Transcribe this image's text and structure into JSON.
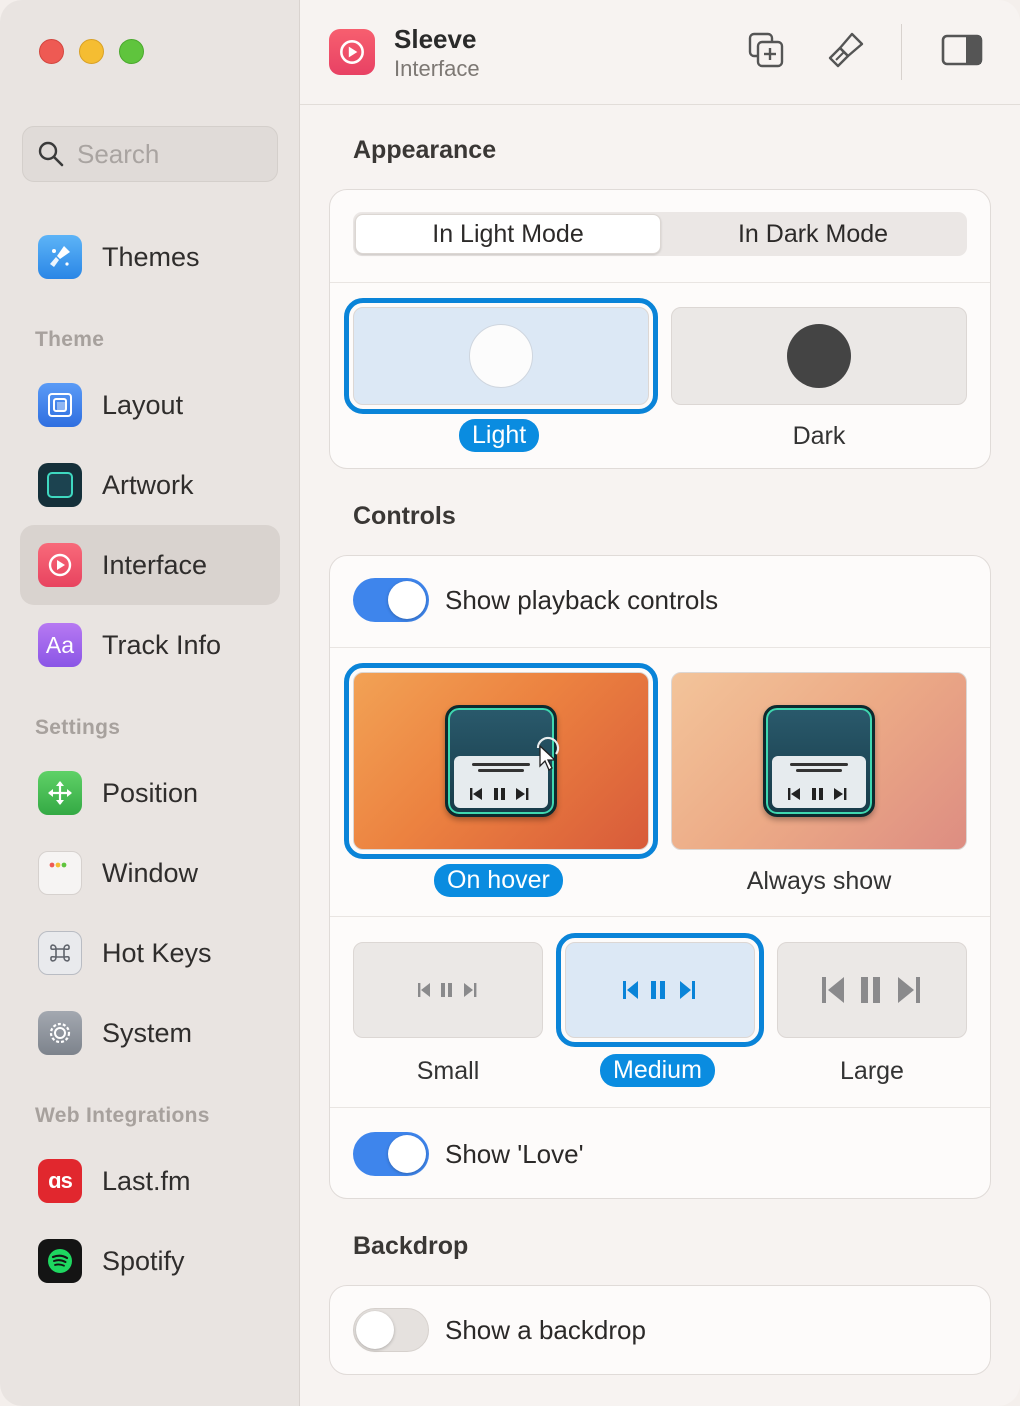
{
  "colors": {
    "accent": "#0a84d8",
    "toggle_on": "#3e85ec",
    "active_pill": "#0a8ce0"
  },
  "sidebar": {
    "search_placeholder": "Search",
    "top_items": [
      {
        "label": "Themes",
        "icon": "paintbrush-icon"
      }
    ],
    "sections": [
      {
        "title": "Theme"
      },
      {
        "title": "Settings"
      },
      {
        "title": "Web Integrations"
      }
    ],
    "items": [
      {
        "label": "Layout",
        "icon": "layout-icon"
      },
      {
        "label": "Artwork",
        "icon": "artwork-icon"
      },
      {
        "label": "Interface",
        "icon": "play-circle-icon",
        "active": true
      },
      {
        "label": "Track Info",
        "icon": "text-aa-icon"
      },
      {
        "label": "Position",
        "icon": "move-arrows-icon"
      },
      {
        "label": "Window",
        "icon": "window-icon"
      },
      {
        "label": "Hot Keys",
        "icon": "command-key-icon"
      },
      {
        "label": "System",
        "icon": "gear-icon"
      },
      {
        "label": "Last.fm",
        "icon": "lastfm-icon"
      },
      {
        "label": "Spotify",
        "icon": "spotify-icon"
      }
    ],
    "track_info_glyph": "Aa",
    "lastfm_glyph": "ɑs"
  },
  "header": {
    "title": "Sleeve",
    "subtitle": "Interface"
  },
  "appearance": {
    "title": "Appearance",
    "modes": [
      "In Light Mode",
      "In Dark Mode"
    ],
    "selected_mode": "In Light Mode",
    "options": [
      {
        "label": "Light",
        "selected": true
      },
      {
        "label": "Dark",
        "selected": false
      }
    ]
  },
  "controls": {
    "title": "Controls",
    "show_playback_label": "Show playback controls",
    "show_playback_on": true,
    "visibility_options": [
      {
        "label": "On hover",
        "selected": true
      },
      {
        "label": "Always show",
        "selected": false
      }
    ],
    "size_options": [
      {
        "label": "Small",
        "selected": false
      },
      {
        "label": "Medium",
        "selected": true
      },
      {
        "label": "Large",
        "selected": false
      }
    ],
    "show_love_label": "Show 'Love'",
    "show_love_on": true
  },
  "backdrop": {
    "title": "Backdrop",
    "show_backdrop_label": "Show a backdrop",
    "show_backdrop_on": false
  }
}
